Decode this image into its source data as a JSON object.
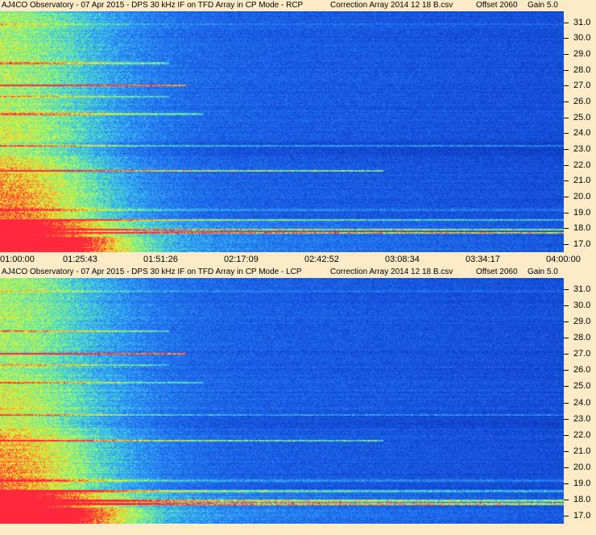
{
  "chart_data": [
    {
      "type": "heatmap",
      "title": {
        "main": "AJ4CO Observatory - 07 Apr 2015 - DPS 30 kHz IF on TFD Array in CP Mode - RCP",
        "correction": "Correction Array 2014 12 18 B.csv",
        "offset": "Offset 2060",
        "gain": "Gain 5.0"
      },
      "xlabel": "",
      "ylabel": "",
      "x_ticks": [
        "01:00:00",
        "01:25:43",
        "01:51:26",
        "02:17:09",
        "02:42:52",
        "03:08:34",
        "03:34:17",
        "04:00:00"
      ],
      "y_ticks": [
        "31.0",
        "30.0",
        "29.0",
        "28.0",
        "27.0",
        "26.0",
        "25.0",
        "24.0",
        "23.0",
        "22.0",
        "21.0",
        "20.0",
        "19.0",
        "18.0",
        "17.0"
      ],
      "ylim": [
        16.5,
        31.7
      ],
      "polarization": "RCP"
    },
    {
      "type": "heatmap",
      "title": {
        "main": "AJ4CO Observatory - 07 Apr 2015 - DPS 30 kHz IF on TFD Array in CP Mode - LCP",
        "correction": "Correction Array 2014 12 18 B.csv",
        "offset": "Offset 2060",
        "gain": "Gain 5.0"
      },
      "xlabel": "",
      "ylabel": "",
      "y_ticks": [
        "31.0",
        "30.0",
        "29.0",
        "28.0",
        "27.0",
        "26.0",
        "25.0",
        "24.0",
        "23.0",
        "22.0",
        "21.0",
        "20.0",
        "19.0",
        "18.0",
        "17.0"
      ],
      "ylim": [
        16.5,
        31.7
      ],
      "polarization": "LCP"
    }
  ],
  "colors": {
    "background": "#fdebc8",
    "low": "#0a2fb0",
    "mid": "#1e6ef0",
    "high_cyan": "#40d0f0",
    "high_green": "#80ff60",
    "high_yellow": "#ffff40",
    "high_red": "#ff3030"
  }
}
